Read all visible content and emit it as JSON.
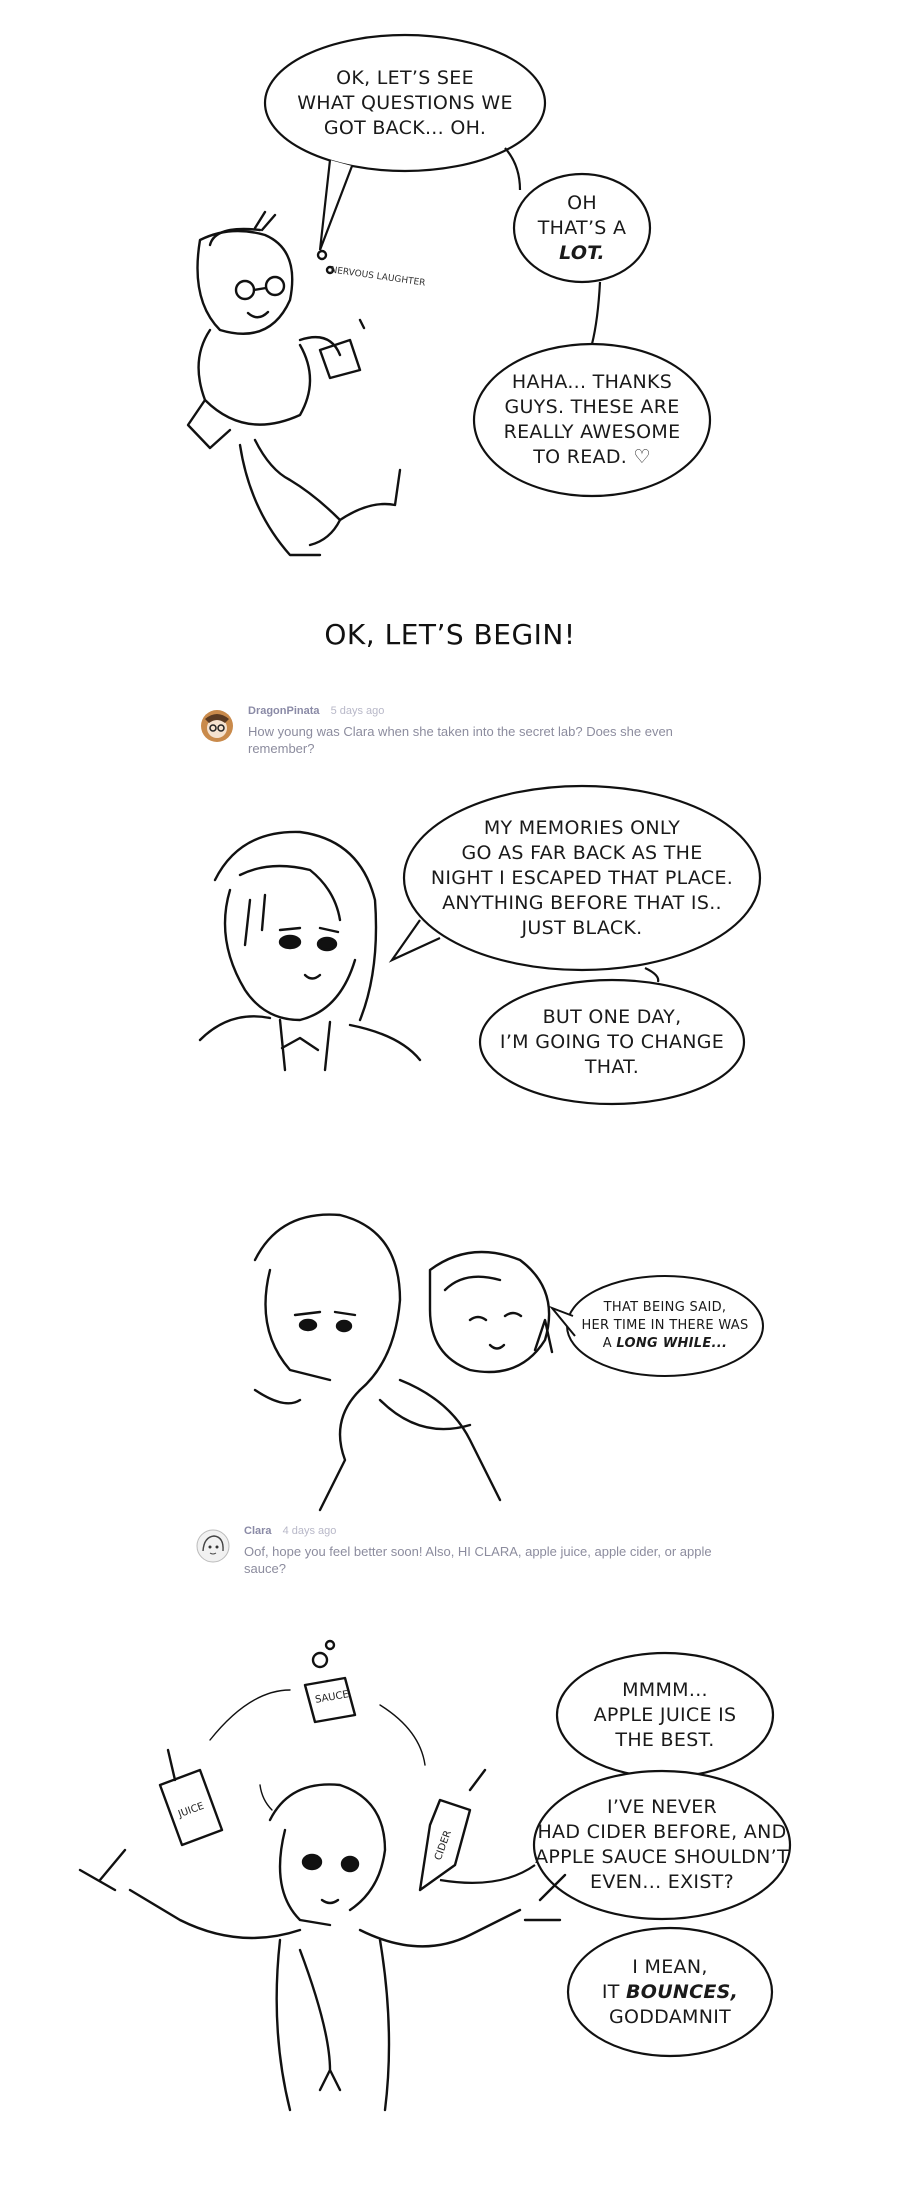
{
  "panel1": {
    "bubble_a": [
      "OK, LET’S SEE",
      "WHAT QUESTIONS WE",
      "GOT BACK... OH."
    ],
    "bubble_b": [
      "OH",
      "THAT’S A",
      "LOT."
    ],
    "bubble_c": [
      "HAHA... THANKS",
      "GUYS. THESE ARE",
      "REALLY AWESOME",
      "TO READ."
    ],
    "sfx": [
      "NERVOUS",
      "LAUGHTER"
    ]
  },
  "heading": "OK, LET’S BEGIN!",
  "comment1": {
    "username": "DragonPinata",
    "time_ago": "5 days ago",
    "text": "How young was Clara when she taken into the secret lab? Does she even remember?"
  },
  "panel2": {
    "bubble_a": [
      "MY MEMORIES ONLY",
      "GO AS FAR BACK AS THE",
      "NIGHT I ESCAPED THAT PLACE.",
      "ANYTHING BEFORE THAT IS..",
      "JUST BLACK."
    ],
    "bubble_b": [
      "BUT ONE DAY,",
      "I’M GOING TO CHANGE",
      "THAT."
    ]
  },
  "panel3": {
    "bubble": [
      "THAT BEING SAID,",
      "HER TIME IN THERE WAS",
      "A",
      "LONG WHILE..."
    ]
  },
  "comment2": {
    "username": "Clara",
    "time_ago": "4 days ago",
    "text": "Oof, hope you feel better soon! Also, HI CLARA, apple juice, apple cider, or apple sauce?"
  },
  "panel4": {
    "bubble_a": [
      "MMMM...",
      "APPLE JUICE IS",
      "THE BEST."
    ],
    "bubble_b": [
      "I’VE NEVER",
      "HAD CIDER BEFORE, AND",
      "APPLE SAUCE SHOULDN’T",
      "EVEN... EXIST?"
    ],
    "bubble_c": [
      "I MEAN,",
      "IT",
      "BOUNCES,",
      "GODDAMNIT"
    ],
    "item_labels": [
      "SAUCE",
      "JUICE",
      "CIDER"
    ]
  },
  "colors": {
    "ink": "#111111",
    "meta_text": "#8c8c9e",
    "username": "#8a8aa6",
    "background": "#ffffff"
  }
}
